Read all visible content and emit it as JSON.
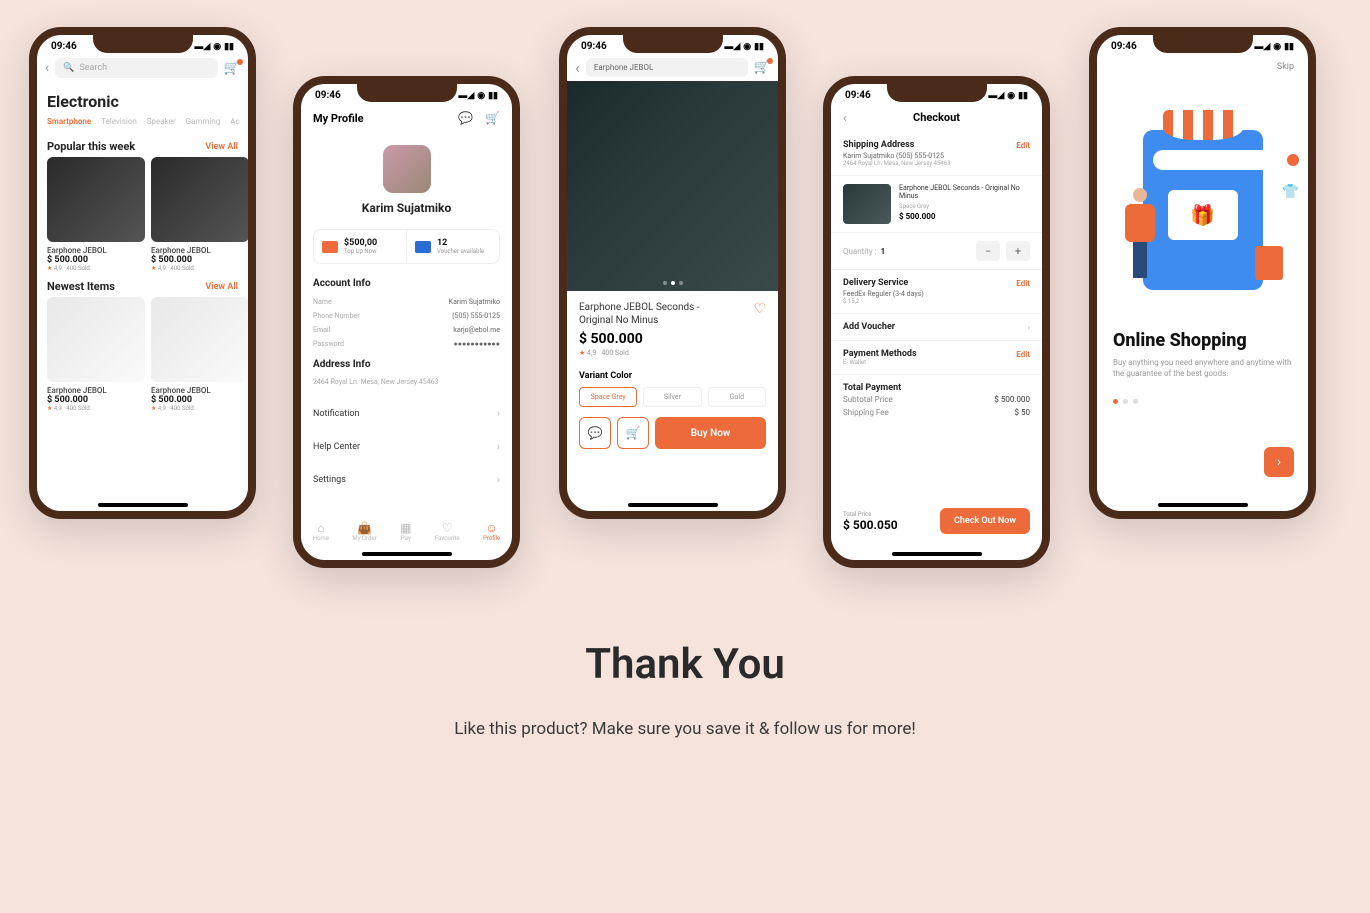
{
  "status": {
    "time": "09:46"
  },
  "p1": {
    "search_ph": "Search",
    "title": "Electronic",
    "tabs": [
      "Smartphone",
      "Television",
      "Speaker",
      "Gamming",
      "Ac"
    ],
    "sec1": {
      "title": "Popular this week",
      "link": "View All"
    },
    "sec2": {
      "title": "Newest Items",
      "link": "View All"
    },
    "prod": {
      "name": "Earphone JEBOL",
      "price": "$ 500.000",
      "rating": "4,9",
      "sold": "400 Sold"
    }
  },
  "p2": {
    "title": "My Profile",
    "name": "Karim Sujatmiko",
    "wallet": {
      "balance": "$500,00",
      "balance_lab": "Top Up Now",
      "vouchers": "12",
      "vouchers_lab": "Voucher available"
    },
    "account_h": "Account Info",
    "info": {
      "name_l": "Name",
      "name_v": "Karim Sujatmiko",
      "phone_l": "Phone Number",
      "phone_v": "(505) 555-0125",
      "email_l": "Email",
      "email_v": "karjo@ebol.me",
      "pass_l": "Password",
      "pass_v": "●●●●●●●●●●●"
    },
    "addr_h": "Address Info",
    "addr": "2464 Royal Ln. Mesa, New Jersey 45463",
    "menu": {
      "notif": "Notification",
      "help": "Help Center",
      "settings": "Settings"
    },
    "tabs": {
      "home": "Home",
      "order": "My Order",
      "pay": "Pay",
      "fav": "Favourite",
      "profile": "Profile"
    }
  },
  "p3": {
    "search": "Earphone JEBOL",
    "title": "Earphone JEBOL Seconds - Original No Minus",
    "price": "$ 500.000",
    "rating": "4,9",
    "sold": "400 Sold",
    "variant_h": "Variant Color",
    "variants": [
      "Space Grey",
      "Silver",
      "Gold"
    ],
    "buy": "Buy Now"
  },
  "p4": {
    "title": "Checkout",
    "edit": "Edit",
    "ship_h": "Shipping Address",
    "ship_name": "Karim Sujatmiko (505) 555-0125",
    "ship_addr": "2464 Royal Ln. Mesa, New Jersey 45463",
    "item": {
      "name": "Earphone JEBOL Seconds - Original No Minus",
      "variant": "Space Grey",
      "price": "$ 500.000"
    },
    "qty_l": "Quantity :",
    "qty_v": "1",
    "delivery_h": "Delivery Service",
    "delivery": "FeedEx Reguler (3-4 days)",
    "delivery_p": "$ 15,2",
    "voucher": "Add Voucher",
    "pay_h": "Payment Methods",
    "pay": "E- Wallet",
    "total_h": "Total Payment",
    "sub_l": "Subtotal Price",
    "sub_v": "$ 500.000",
    "fee_l": "Shipping Fee",
    "fee_v": "$ 50",
    "totl": "Total Price",
    "totv": "$ 500.050",
    "checkout": "Check Out Now"
  },
  "p5": {
    "skip": "Skip",
    "title": "Online Shopping",
    "desc": "Buy anything you need anywhere and anytime with the guarantee of the best goods."
  },
  "footer": {
    "title": "Thank You",
    "sub": "Like this product? Make sure you save it & follow us for more!"
  }
}
